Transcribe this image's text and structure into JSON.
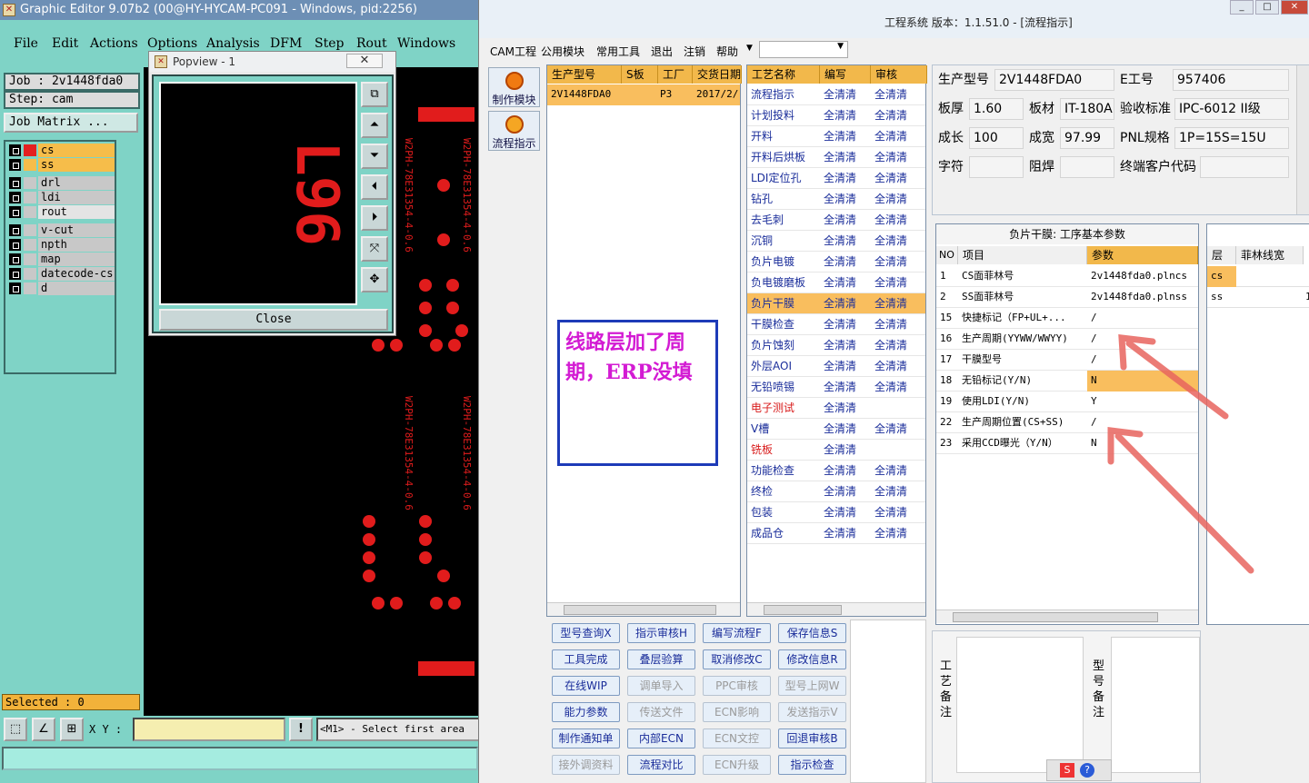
{
  "ge": {
    "title": "Graphic Editor 9.07b2 (00@HY-HYCAM-PC091 - Windows, pid:2256)",
    "menu": [
      "File",
      "Edit",
      "Actions",
      "Options",
      "Analysis",
      "DFM",
      "Step",
      "Rout",
      "Windows"
    ],
    "job": "Job : 2v1448fda0",
    "step": "Step: cam",
    "job_matrix": "Job Matrix ...",
    "layers": [
      {
        "name": "cs",
        "color": "#e32020",
        "bg": "#f6bd4a"
      },
      {
        "name": "ss",
        "color": "#f6bd4a",
        "bg": "#f6bd4a"
      },
      {
        "name": "drl",
        "color": "#c8c8c8",
        "bg": "#c8c8c8"
      },
      {
        "name": "ldi",
        "color": "#c8c8c8",
        "bg": "#c8c8c8"
      },
      {
        "name": "rout",
        "color": "#c8c8c8",
        "bg": "#e4e4e4"
      },
      {
        "name": "v-cut",
        "color": "#c8c8c8",
        "bg": "#c8c8c8"
      },
      {
        "name": "npth",
        "color": "#c8c8c8",
        "bg": "#c8c8c8"
      },
      {
        "name": "map",
        "color": "#c8c8c8",
        "bg": "#c8c8c8"
      },
      {
        "name": "datecode-cs",
        "color": "#c8c8c8",
        "bg": "#c8c8c8"
      },
      {
        "name": "d",
        "color": "#c8c8c8",
        "bg": "#c8c8c8"
      }
    ],
    "selected": "Selected : 0",
    "xy_label": "X Y :",
    "xy_value": "",
    "status": "<M1> - Select first area",
    "popview_title": "Popview - 1",
    "popview_close": "Close",
    "popview_text": "L96",
    "board_text": "W2PH-78E31354-4-0.6"
  },
  "erp": {
    "title": "工程系统   版本：1.1.51.0 - [流程指示]",
    "menu": [
      "CAM工程",
      "公用模块",
      "常用工具",
      "退出",
      "注销",
      "帮助"
    ],
    "side_buttons": [
      "制作模块",
      "流程指示"
    ],
    "order_table": {
      "headers": [
        "生产型号",
        "S板",
        "工厂",
        "交货日期"
      ],
      "rows": [
        [
          "2V1448FDA0",
          "",
          "P3",
          "2017/2/"
        ]
      ]
    },
    "process_table": {
      "headers": [
        "工艺名称",
        "编写",
        "审核"
      ],
      "rows": [
        [
          "流程指示",
          "全清清",
          "全清清"
        ],
        [
          "计划投料",
          "全清清",
          "全清清"
        ],
        [
          "开料",
          "全清清",
          "全清清"
        ],
        [
          "开料后烘板",
          "全清清",
          "全清清"
        ],
        [
          "LDI定位孔",
          "全清清",
          "全清清"
        ],
        [
          "钻孔",
          "全清清",
          "全清清"
        ],
        [
          "去毛刺",
          "全清清",
          "全清清"
        ],
        [
          "沉铜",
          "全清清",
          "全清清"
        ],
        [
          "负片电镀",
          "全清清",
          "全清清"
        ],
        [
          "负电镀磨板",
          "全清清",
          "全清清"
        ],
        [
          "负片干膜",
          "全清清",
          "全清清"
        ],
        [
          "干膜检查",
          "全清清",
          "全清清"
        ],
        [
          "负片蚀刻",
          "全清清",
          "全清清"
        ],
        [
          "外层AOI",
          "全清清",
          "全清清"
        ],
        [
          "无铅喷锡",
          "全清清",
          "全清清"
        ],
        [
          "电子测试",
          "全清清",
          ""
        ],
        [
          "V槽",
          "全清清",
          "全清清"
        ],
        [
          "铣板",
          "全清清",
          ""
        ],
        [
          "功能检查",
          "全清清",
          "全清清"
        ],
        [
          "终检",
          "全清清",
          "全清清"
        ],
        [
          "包装",
          "全清清",
          "全清清"
        ],
        [
          "成品仓",
          "全清清",
          "全清清"
        ]
      ],
      "selected_index": 10,
      "red_rows": [
        15,
        17
      ]
    },
    "info": {
      "model_label": "生产型号",
      "model": "2V1448FDA0",
      "eno_label": "E工号",
      "eno": "957406",
      "thick_label": "板厚",
      "thick": "1.60",
      "mat_label": "板材",
      "mat": "IT-180A",
      "std_label": "验收标准",
      "std": "IPC-6012 II级",
      "len_label": "成长",
      "len": "100",
      "wid_label": "成宽",
      "wid": "97.99",
      "pnl_label": "PNL规格",
      "pnl": "1P=15S=15U",
      "char_label": "字符",
      "char": "",
      "mask_label": "阻焊",
      "mask": "",
      "cust_label": "终端客户代码",
      "cust": ""
    },
    "param_panel": {
      "title": "负片干膜: 工序基本参数",
      "headers": [
        "NO",
        "项目",
        "参数"
      ],
      "rows": [
        [
          "1",
          "CS面菲林号",
          "2v1448fda0.plncs"
        ],
        [
          "2",
          "SS面菲林号",
          "2v1448fda0.plnss"
        ],
        [
          "15",
          "快捷标记（FP+UL+...",
          "/"
        ],
        [
          "16",
          "生产周期(YYWW/WWYY)",
          "/"
        ],
        [
          "17",
          "干膜型号",
          "/"
        ],
        [
          "18",
          "无铅标记(Y/N)",
          "N"
        ],
        [
          "19",
          "使用LDI(Y/N)",
          "Y"
        ],
        [
          "22",
          "生产周期位置(CS+SS)",
          "/"
        ],
        [
          "23",
          "采用CCD曝光（Y/N）",
          "N"
        ]
      ],
      "highlight_index": 5
    },
    "film_panel": {
      "headers": [
        "层",
        "菲林线宽"
      ],
      "rows": [
        [
          "cs",
          ""
        ],
        [
          "ss",
          ""
        ]
      ]
    },
    "buttons": [
      [
        "型号查询X",
        "指示审核H",
        "编写流程F",
        "保存信息S"
      ],
      [
        "工具完成",
        "叠层验算",
        "取消修改C",
        "修改信息R"
      ],
      [
        "在线WIP",
        "调单导入",
        "PPC审核",
        "型号上网W"
      ],
      [
        "能力参数",
        "传送文件",
        "ECN影响",
        "发送指示V"
      ],
      [
        "制作通知单",
        "内部ECN",
        "ECN文控",
        "回退审核B"
      ],
      [
        "接外调资料",
        "流程对比",
        "ECN升级",
        "指示检查"
      ]
    ],
    "disabled_buttons": [
      "调单导入",
      "PPC审核",
      "型号上网W",
      "传送文件",
      "ECN影响",
      "发送指示V",
      "ECN文控",
      "ECN升级",
      "接外调资料"
    ],
    "process_note_label": "工艺备注",
    "model_note_label": "型号备注",
    "annotation": "线路层加了周期，ERP没填",
    "film_row_value": "1"
  }
}
